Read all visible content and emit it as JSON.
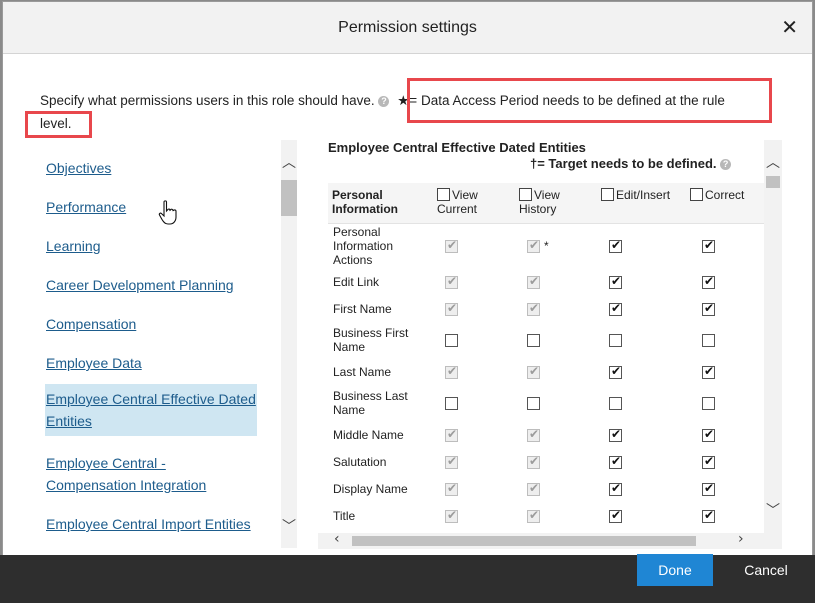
{
  "dialog": {
    "title": "Permission settings",
    "close_icon": "close-icon",
    "intro_text": "Specify what permissions users in this role should have.",
    "data_access_note": "★= Data Access Period needs to be defined at the rule",
    "data_access_note_cont": "level.",
    "highlight_color": "#e8474c"
  },
  "sidebar": {
    "items": [
      {
        "label": "Objectives"
      },
      {
        "label": "Performance"
      },
      {
        "label": "Learning"
      },
      {
        "label": "Career Development Planning"
      },
      {
        "label": "Compensation"
      },
      {
        "label": "Employee Data"
      },
      {
        "label": "Employee Central Effective Dated Entities",
        "active": true
      },
      {
        "label": "Employee Central - Compensation Integration"
      },
      {
        "label": "Employee Central Import Entities"
      }
    ]
  },
  "panel": {
    "title": "Employee Central Effective Dated Entities",
    "target_note": "†= Target needs to be defined.",
    "columns": [
      "Personal Information",
      "View Current",
      "View History",
      "Edit/Insert",
      "Correct"
    ],
    "rows": [
      {
        "label": "Personal Information Actions",
        "checks": [
          true,
          true,
          true,
          true
        ],
        "disabled": [
          true,
          true,
          false,
          false
        ],
        "marker": "*"
      },
      {
        "label": "Edit Link",
        "checks": [
          true,
          true,
          true,
          true
        ],
        "disabled": [
          true,
          true,
          false,
          false
        ]
      },
      {
        "label": "First Name",
        "checks": [
          true,
          true,
          true,
          true
        ],
        "disabled": [
          true,
          true,
          false,
          false
        ]
      },
      {
        "label": "Business First Name",
        "checks": [
          false,
          false,
          false,
          false
        ],
        "disabled": [
          false,
          false,
          false,
          false
        ]
      },
      {
        "label": "Last Name",
        "checks": [
          true,
          true,
          true,
          true
        ],
        "disabled": [
          true,
          true,
          false,
          false
        ]
      },
      {
        "label": "Business Last Name",
        "checks": [
          false,
          false,
          false,
          false
        ],
        "disabled": [
          false,
          false,
          false,
          false
        ]
      },
      {
        "label": "Middle Name",
        "checks": [
          true,
          true,
          true,
          true
        ],
        "disabled": [
          true,
          true,
          false,
          false
        ]
      },
      {
        "label": "Salutation",
        "checks": [
          true,
          true,
          true,
          true
        ],
        "disabled": [
          true,
          true,
          false,
          false
        ]
      },
      {
        "label": "Display Name",
        "checks": [
          true,
          true,
          true,
          true
        ],
        "disabled": [
          true,
          true,
          false,
          false
        ]
      },
      {
        "label": "Title",
        "checks": [
          true,
          true,
          true,
          true
        ],
        "disabled": [
          true,
          true,
          false,
          false
        ]
      }
    ]
  },
  "footer": {
    "done_label": "Done",
    "cancel_label": "Cancel",
    "accent_color": "#1f86d4"
  }
}
